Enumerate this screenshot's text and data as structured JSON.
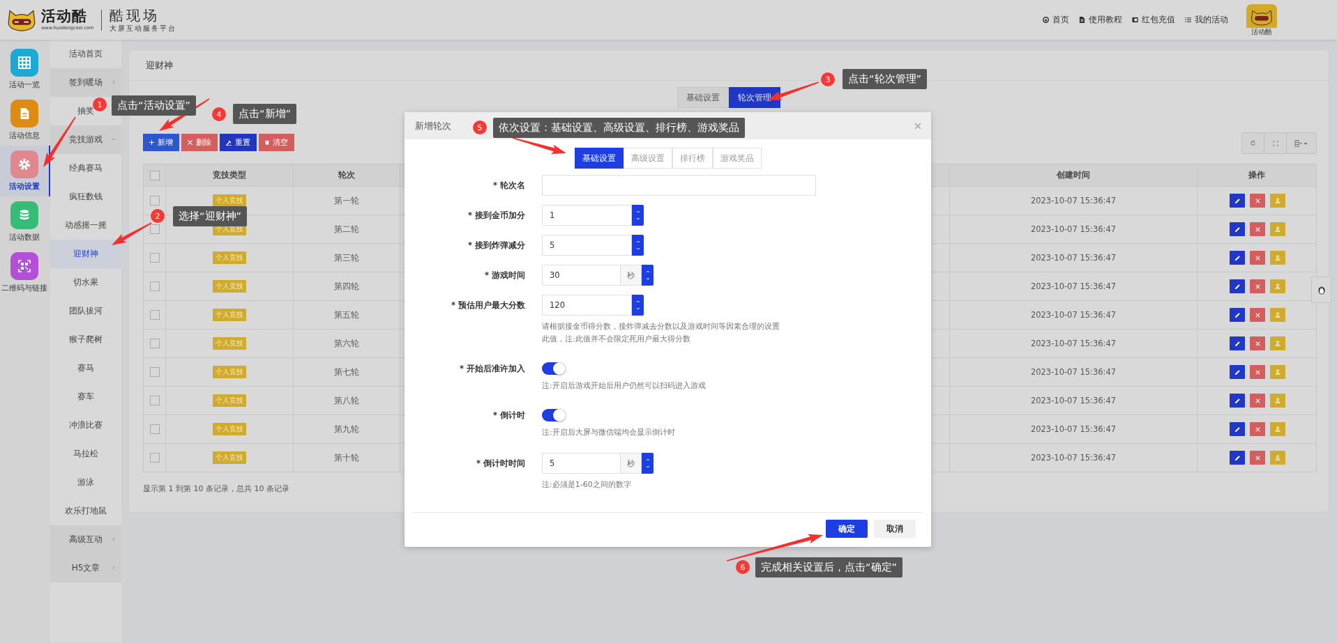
{
  "header": {
    "logo_title": "活动酷",
    "logo_url": "www.huodongcool.com",
    "brand": "酷现场",
    "slogan": "大屏互动服务平台",
    "nav": [
      {
        "label": "首页"
      },
      {
        "label": "使用教程"
      },
      {
        "label": "红包充值"
      },
      {
        "label": "我的活动"
      }
    ],
    "avatar_caption": "活动酷"
  },
  "icon_sidebar": [
    {
      "label": "活动一览",
      "selected": false,
      "color": "#1ba9d6"
    },
    {
      "label": "活动信息",
      "selected": false,
      "color": "#df8a10"
    },
    {
      "label": "活动设置",
      "selected": true,
      "color": "#e0878f"
    },
    {
      "label": "活动数据",
      "selected": false,
      "color": "#35bd78"
    },
    {
      "label": "二维码与链接",
      "selected": false,
      "color": "#b34fd9"
    }
  ],
  "subnav": [
    {
      "label": "活动首页",
      "kind": "link",
      "selected": false
    },
    {
      "label": "签到暖场",
      "kind": "group",
      "expanded": false
    },
    {
      "label": "抽奖",
      "kind": "link",
      "selected": false
    },
    {
      "label": "竞技游戏",
      "kind": "group",
      "expanded": true,
      "children": [
        {
          "label": "经典赛马",
          "selected": false
        },
        {
          "label": "疯狂数钱",
          "selected": false
        },
        {
          "label": "动感摇一摇",
          "selected": false
        },
        {
          "label": "迎财神",
          "selected": true
        },
        {
          "label": "切水果",
          "selected": false
        },
        {
          "label": "团队拔河",
          "selected": false
        },
        {
          "label": "猴子爬树",
          "selected": false
        },
        {
          "label": "赛马",
          "selected": false
        },
        {
          "label": "赛车",
          "selected": false
        },
        {
          "label": "冲浪比赛",
          "selected": false
        },
        {
          "label": "马拉松",
          "selected": false
        },
        {
          "label": "游泳",
          "selected": false
        },
        {
          "label": "欢乐打地鼠",
          "selected": false
        }
      ]
    },
    {
      "label": "高级互动",
      "kind": "group",
      "expanded": false
    },
    {
      "label": "H5文章",
      "kind": "group",
      "expanded": false
    }
  ],
  "panel": {
    "title": "迎财神",
    "tabs": [
      {
        "label": "基础设置",
        "selected": false
      },
      {
        "label": "轮次管理",
        "selected": true
      }
    ],
    "toolbar": [
      {
        "label": "新增",
        "kind": "add"
      },
      {
        "label": "删除",
        "kind": "delete"
      },
      {
        "label": "重置",
        "kind": "reset"
      },
      {
        "label": "清空",
        "kind": "clear"
      }
    ],
    "table": {
      "select_all_checked": false,
      "columns": [
        "竞技类型",
        "轮次",
        "创建时间",
        "操作"
      ],
      "rows": [
        {
          "checked": false,
          "type": "个人竞技",
          "round": "第一轮",
          "created": "2023-10-07 15:36:47"
        },
        {
          "checked": false,
          "type": "个人竞技",
          "round": "第二轮",
          "created": "2023-10-07 15:36:47"
        },
        {
          "checked": false,
          "type": "个人竞技",
          "round": "第三轮",
          "created": "2023-10-07 15:36:47"
        },
        {
          "checked": false,
          "type": "个人竞技",
          "round": "第四轮",
          "created": "2023-10-07 15:36:47"
        },
        {
          "checked": false,
          "type": "个人竞技",
          "round": "第五轮",
          "created": "2023-10-07 15:36:47"
        },
        {
          "checked": false,
          "type": "个人竞技",
          "round": "第六轮",
          "created": "2023-10-07 15:36:47"
        },
        {
          "checked": false,
          "type": "个人竞技",
          "round": "第七轮",
          "created": "2023-10-07 15:36:47"
        },
        {
          "checked": false,
          "type": "个人竞技",
          "round": "第八轮",
          "created": "2023-10-07 15:36:47"
        },
        {
          "checked": false,
          "type": "个人竞技",
          "round": "第九轮",
          "created": "2023-10-07 15:36:47"
        },
        {
          "checked": false,
          "type": "个人竞技",
          "round": "第十轮",
          "created": "2023-10-07 15:36:47"
        }
      ]
    },
    "footer": "显示第 1 到第 10 条记录，总共 10 条记录"
  },
  "modal": {
    "title": "新增轮次",
    "tabs": [
      {
        "label": "基础设置",
        "selected": true
      },
      {
        "label": "高级设置",
        "selected": false
      },
      {
        "label": "排行榜",
        "selected": false
      },
      {
        "label": "游戏奖品",
        "selected": false
      }
    ],
    "fields": [
      {
        "kind": "text",
        "label": "* 轮次名"
      },
      {
        "kind": "number",
        "label": "* 接到金币加分",
        "value": "1"
      },
      {
        "kind": "number",
        "label": "* 接到炸弹减分",
        "value": "5"
      },
      {
        "kind": "number",
        "label": "* 游戏时间",
        "value": "30",
        "unit": "秒"
      },
      {
        "kind": "number",
        "label": "* 预估用户最大分数",
        "value": "120",
        "help": "请根据接金币得分数，接炸弹减去分数以及游戏时间等因素合理的设置此值，注:此值并不会限定死用户最大得分数"
      },
      {
        "kind": "toggle",
        "label": "* 开始后准许加入",
        "on": true,
        "help": "注:开启后游戏开始后用户仍然可以扫码进入游戏"
      },
      {
        "kind": "toggle",
        "label": "* 倒计时",
        "on": true,
        "help": "注:开启后大屏与微信端均会显示倒计时"
      },
      {
        "kind": "number",
        "label": "* 倒计时时间",
        "value": "5",
        "unit": "秒",
        "help": "注:必须是1-60之间的数字"
      }
    ],
    "buttons": [
      {
        "label": "确定",
        "kind": "primary"
      },
      {
        "label": "取消",
        "kind": "secondary"
      }
    ]
  },
  "annotations": [
    {
      "number": "1",
      "text": "点击“活动设置”"
    },
    {
      "number": "2",
      "text": "选择“迎财神”"
    },
    {
      "number": "3",
      "text": "点击“轮次管理”"
    },
    {
      "number": "4",
      "text": "点击“新增”"
    },
    {
      "number": "5",
      "text": "依次设置：基础设置、高级设置、排行榜、游戏奖品"
    },
    {
      "number": "6",
      "text": "完成相关设置后，点击“确定”"
    }
  ]
}
